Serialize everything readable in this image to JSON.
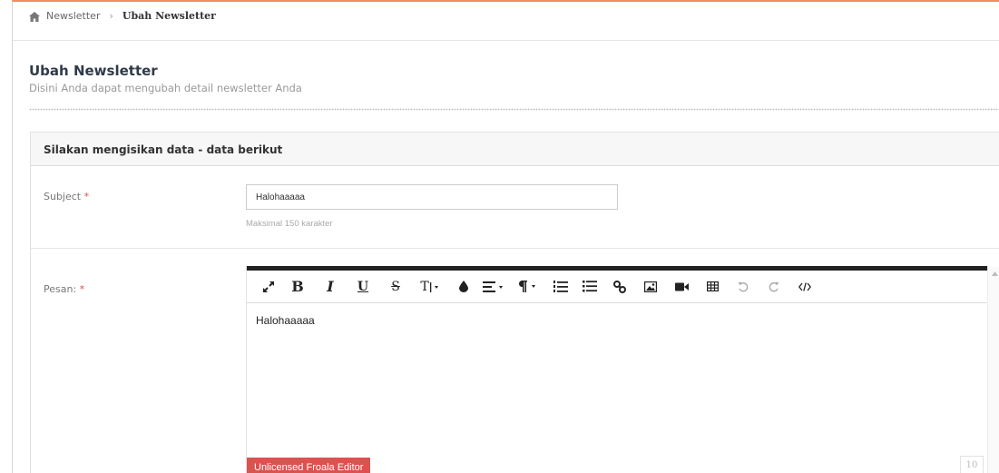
{
  "breadcrumb": {
    "home": "Newsletter",
    "separator": "›",
    "current": "Ubah Newsletter"
  },
  "header": {
    "title": "Ubah Newsletter",
    "subtitle": "Disini Anda dapat mengubah detail newsletter Anda"
  },
  "panel": {
    "heading": "Silakan mengisikan data - data berikut",
    "subject": {
      "label": "Subject",
      "required_mark": "*",
      "value": "Halohaaaaa",
      "help": "Maksimal 150 karakter"
    },
    "message": {
      "label": "Pesan:",
      "required_mark": "*",
      "content": "Halohaaaaa",
      "license_badge": "Unlicensed Froala Editor",
      "char_counter": "10"
    }
  },
  "toolbar": {
    "bold": "B",
    "italic": "I",
    "underline": "U",
    "strike": "S",
    "font_size": "T",
    "icons": [
      "fullscreen-icon",
      "bold-icon",
      "italic-icon",
      "underline-icon",
      "strikethrough-icon",
      "font-size-icon",
      "color-icon",
      "align-icon",
      "paragraph-format-icon",
      "ordered-list-icon",
      "unordered-list-icon",
      "link-icon",
      "image-icon",
      "video-icon",
      "table-icon",
      "undo-icon",
      "redo-icon",
      "html-icon"
    ]
  },
  "colors": {
    "accent_top": "#f08c5e",
    "license_red": "#d9534f",
    "required_red": "#d9534f"
  }
}
